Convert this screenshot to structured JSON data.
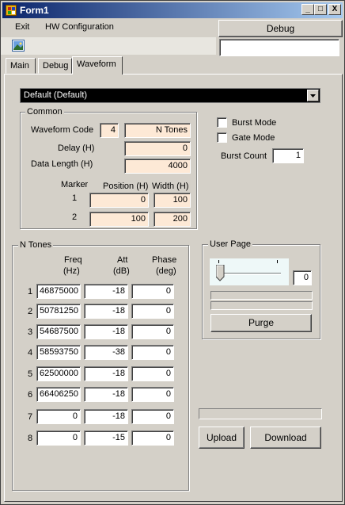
{
  "window": {
    "title": "Form1",
    "min": "_",
    "max": "□",
    "close": "X"
  },
  "menu": {
    "exit": "Exit",
    "hw": "HW Configuration"
  },
  "toolbar": {
    "debug_button": "Debug",
    "debug_field": ""
  },
  "tabs": [
    "Main",
    "Debug",
    "Waveform"
  ],
  "waveform_select": {
    "value": "Default (Default)"
  },
  "common": {
    "title": "Common",
    "waveform_code_label": "Waveform Code",
    "waveform_code": "4",
    "waveform_name": "N Tones",
    "delay_label": "Delay (H)",
    "delay": "0",
    "data_length_label": "Data Length (H)",
    "data_length": "4000",
    "marker_label": "Marker",
    "position_label": "Position (H)",
    "width_label": "Width (H)",
    "markers": [
      {
        "n": "1",
        "position": "0",
        "width": "100"
      },
      {
        "n": "2",
        "position": "100",
        "width": "200"
      }
    ]
  },
  "modes": {
    "burst_mode": "Burst Mode",
    "gate_mode": "Gate Mode",
    "burst_count_label": "Burst Count",
    "burst_count": "1"
  },
  "ntones": {
    "title": "N Tones",
    "freq_header": "Freq",
    "freq_unit": "(Hz)",
    "att_header": "Att",
    "att_unit": "(dB)",
    "phase_header": "Phase",
    "phase_unit": "(deg)",
    "rows": [
      {
        "n": "1",
        "freq": "46875000",
        "att": "-18",
        "phase": "0"
      },
      {
        "n": "2",
        "freq": "50781250",
        "att": "-18",
        "phase": "0"
      },
      {
        "n": "3",
        "freq": "54687500",
        "att": "-18",
        "phase": "0"
      },
      {
        "n": "4",
        "freq": "58593750",
        "att": "-38",
        "phase": "0"
      },
      {
        "n": "5",
        "freq": "62500000",
        "att": "-18",
        "phase": "0"
      },
      {
        "n": "6",
        "freq": "66406250",
        "att": "-18",
        "phase": "0"
      },
      {
        "n": "7",
        "freq": "0",
        "att": "-18",
        "phase": "0"
      },
      {
        "n": "8",
        "freq": "0",
        "att": "-15",
        "phase": "0"
      }
    ]
  },
  "user_page": {
    "title": "User Page",
    "value": "0",
    "slider_fraction": 0,
    "purge": "Purge"
  },
  "actions": {
    "upload": "Upload",
    "download": "Download"
  }
}
